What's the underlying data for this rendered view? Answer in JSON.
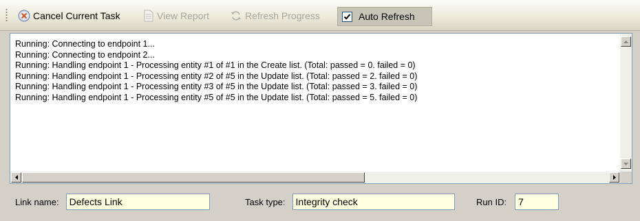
{
  "toolbar": {
    "cancel_label": "Cancel Current Task",
    "view_report_label": "View Report",
    "refresh_progress_label": "Refresh Progress",
    "auto_refresh_label": "Auto Refresh",
    "auto_refresh_checked": true
  },
  "log": {
    "lines": [
      "Running: Connecting to endpoint 1...",
      "Running: Connecting to endpoint 2...",
      "Running: Handling endpoint 1 - Processing entity #1 of #1 in the Create list. (Total: passed = 0. failed = 0)",
      "Running: Handling endpoint 1 - Processing entity #2 of #5 in the Update list. (Total: passed = 2. failed = 0)",
      "Running: Handling endpoint 1 - Processing entity #3 of #5 in the Update list. (Total: passed = 3. failed = 0)",
      "Running: Handling endpoint 1 - Processing entity #5 of #5 in the Update list. (Total: passed = 5. failed = 0)"
    ]
  },
  "fields": {
    "link_name_label": "Link name:",
    "link_name_value": "Defects Link",
    "task_type_label": "Task type:",
    "task_type_value": "Integrity check",
    "run_id_label": "Run ID:",
    "run_id_value": "7"
  }
}
